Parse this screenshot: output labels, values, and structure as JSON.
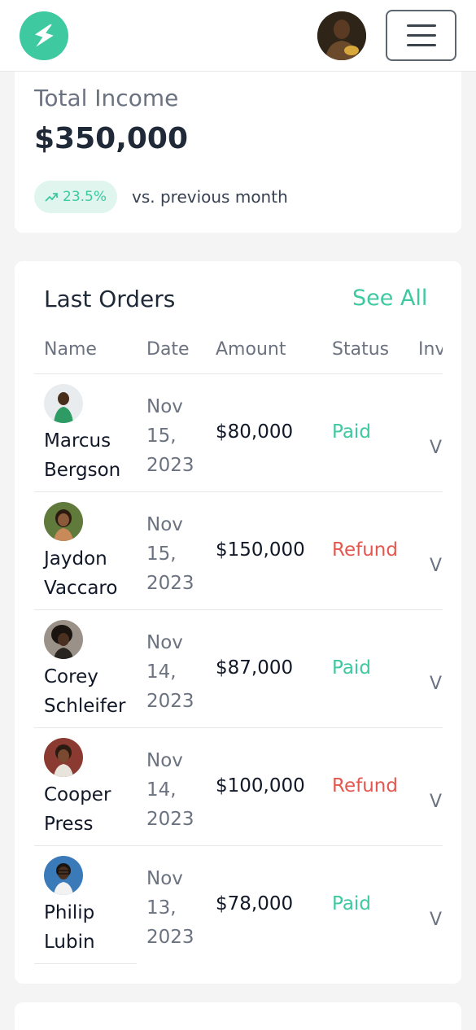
{
  "header": {
    "logo_icon": "lightning-bolt-icon",
    "user_avatar": "user-avatar",
    "menu_icon": "hamburger-menu-icon"
  },
  "income": {
    "title": "Total Income",
    "value": "$350,000",
    "change": "23.5%",
    "change_icon": "trend-up-icon",
    "comparison": "vs. previous month"
  },
  "orders": {
    "title": "Last Orders",
    "see_all": "See All",
    "columns": [
      "Name",
      "Date",
      "Amount",
      "Status",
      "Inv"
    ],
    "rows": [
      {
        "name": "Marcus Bergson",
        "date": "Nov 15, 2023",
        "amount": "$80,000",
        "status": "Paid",
        "invoice": "V"
      },
      {
        "name": "Jaydon Vaccaro",
        "date": "Nov 15, 2023",
        "amount": "$150,000",
        "status": "Refund",
        "invoice": "V"
      },
      {
        "name": "Corey Schleifer",
        "date": "Nov 14, 2023",
        "amount": "$87,000",
        "status": "Paid",
        "invoice": "V"
      },
      {
        "name": "Cooper Press",
        "date": "Nov 14, 2023",
        "amount": "$100,000",
        "status": "Refund",
        "invoice": "V"
      },
      {
        "name": "Philip Lubin",
        "date": "Nov 13, 2023",
        "amount": "$78,000",
        "status": "Paid",
        "invoice": "V"
      }
    ]
  },
  "colors": {
    "accent": "#3ec9a0",
    "paid": "#3ec9a0",
    "refund": "#e3574f",
    "background": "#f4f4f4"
  }
}
